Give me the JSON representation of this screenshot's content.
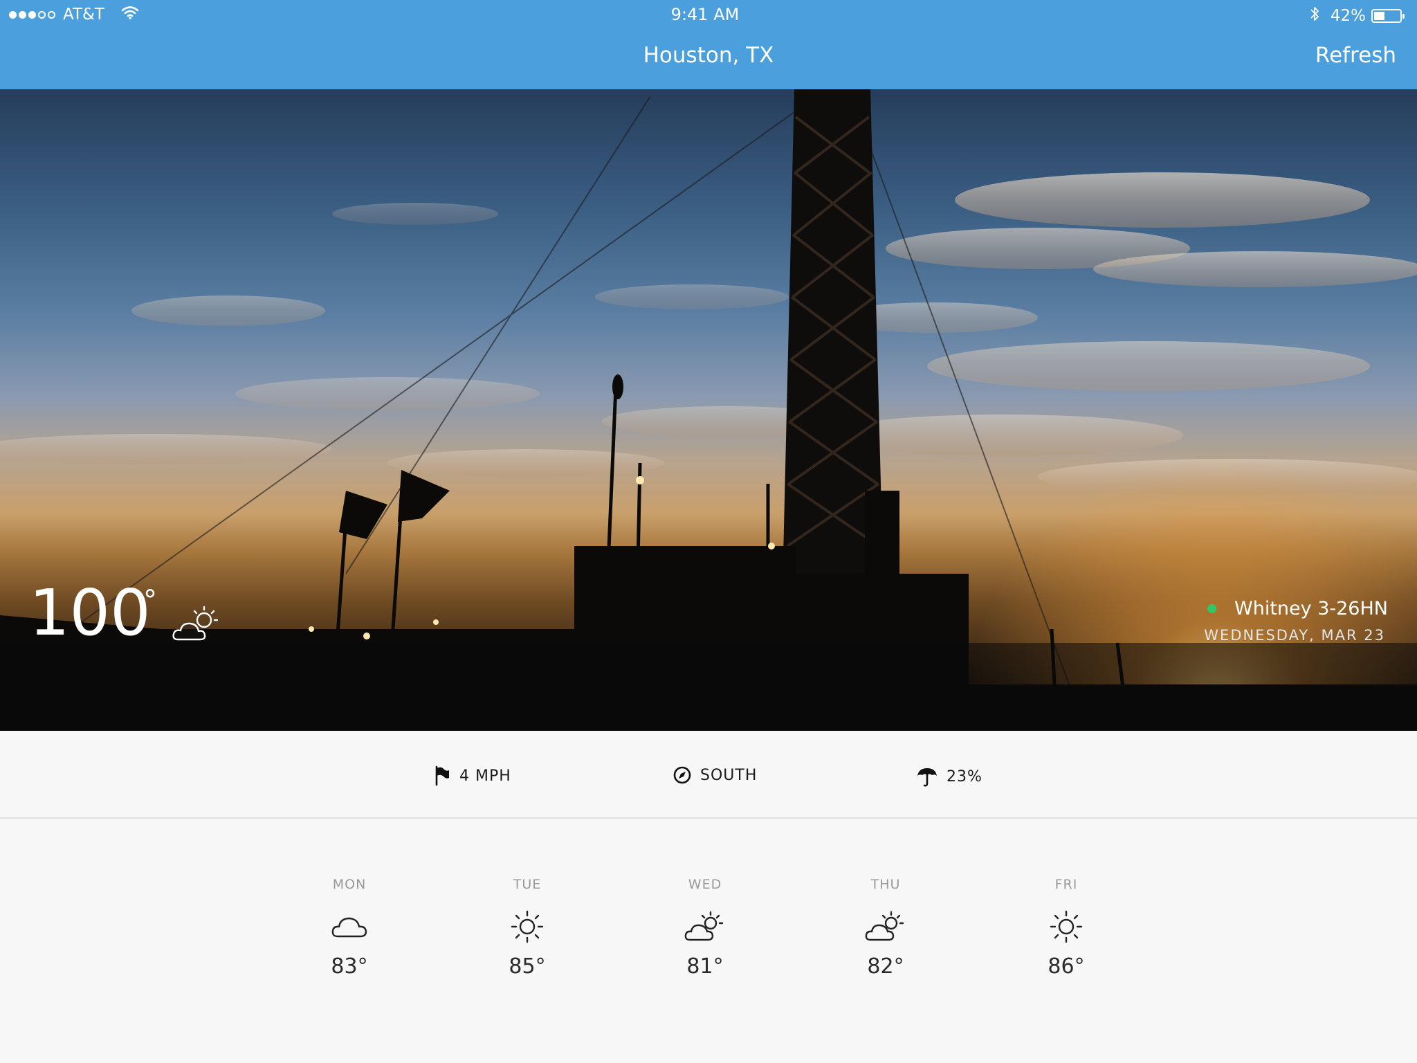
{
  "status_bar": {
    "carrier": "AT&T",
    "signal_bars_filled": 3,
    "signal_bars_total": 5,
    "time": "9:41 AM",
    "battery_percent": "42%",
    "battery_level": 0.42
  },
  "nav": {
    "title": "Houston, TX",
    "refresh_label": "Refresh"
  },
  "current": {
    "temperature": "100",
    "degree_symbol": "°",
    "condition_icon": "partly-cloudy-icon",
    "site_name": "Whitney 3-26HN",
    "site_status_color": "#2ec866",
    "date": "WEDNESDAY, MAR 23"
  },
  "stats": {
    "wind_speed": "4 MPH",
    "wind_direction": "SOUTH",
    "precipitation": "23%"
  },
  "forecast": [
    {
      "day": "MON",
      "icon": "cloud-icon",
      "temp": "83°"
    },
    {
      "day": "TUE",
      "icon": "sun-icon",
      "temp": "85°"
    },
    {
      "day": "WED",
      "icon": "partly-cloudy-icon",
      "temp": "81°"
    },
    {
      "day": "THU",
      "icon": "partly-cloudy-icon",
      "temp": "82°"
    },
    {
      "day": "FRI",
      "icon": "sun-icon",
      "temp": "86°"
    }
  ],
  "colors": {
    "header_blue": "#4a9fdc",
    "background": "#f7f7f7"
  }
}
